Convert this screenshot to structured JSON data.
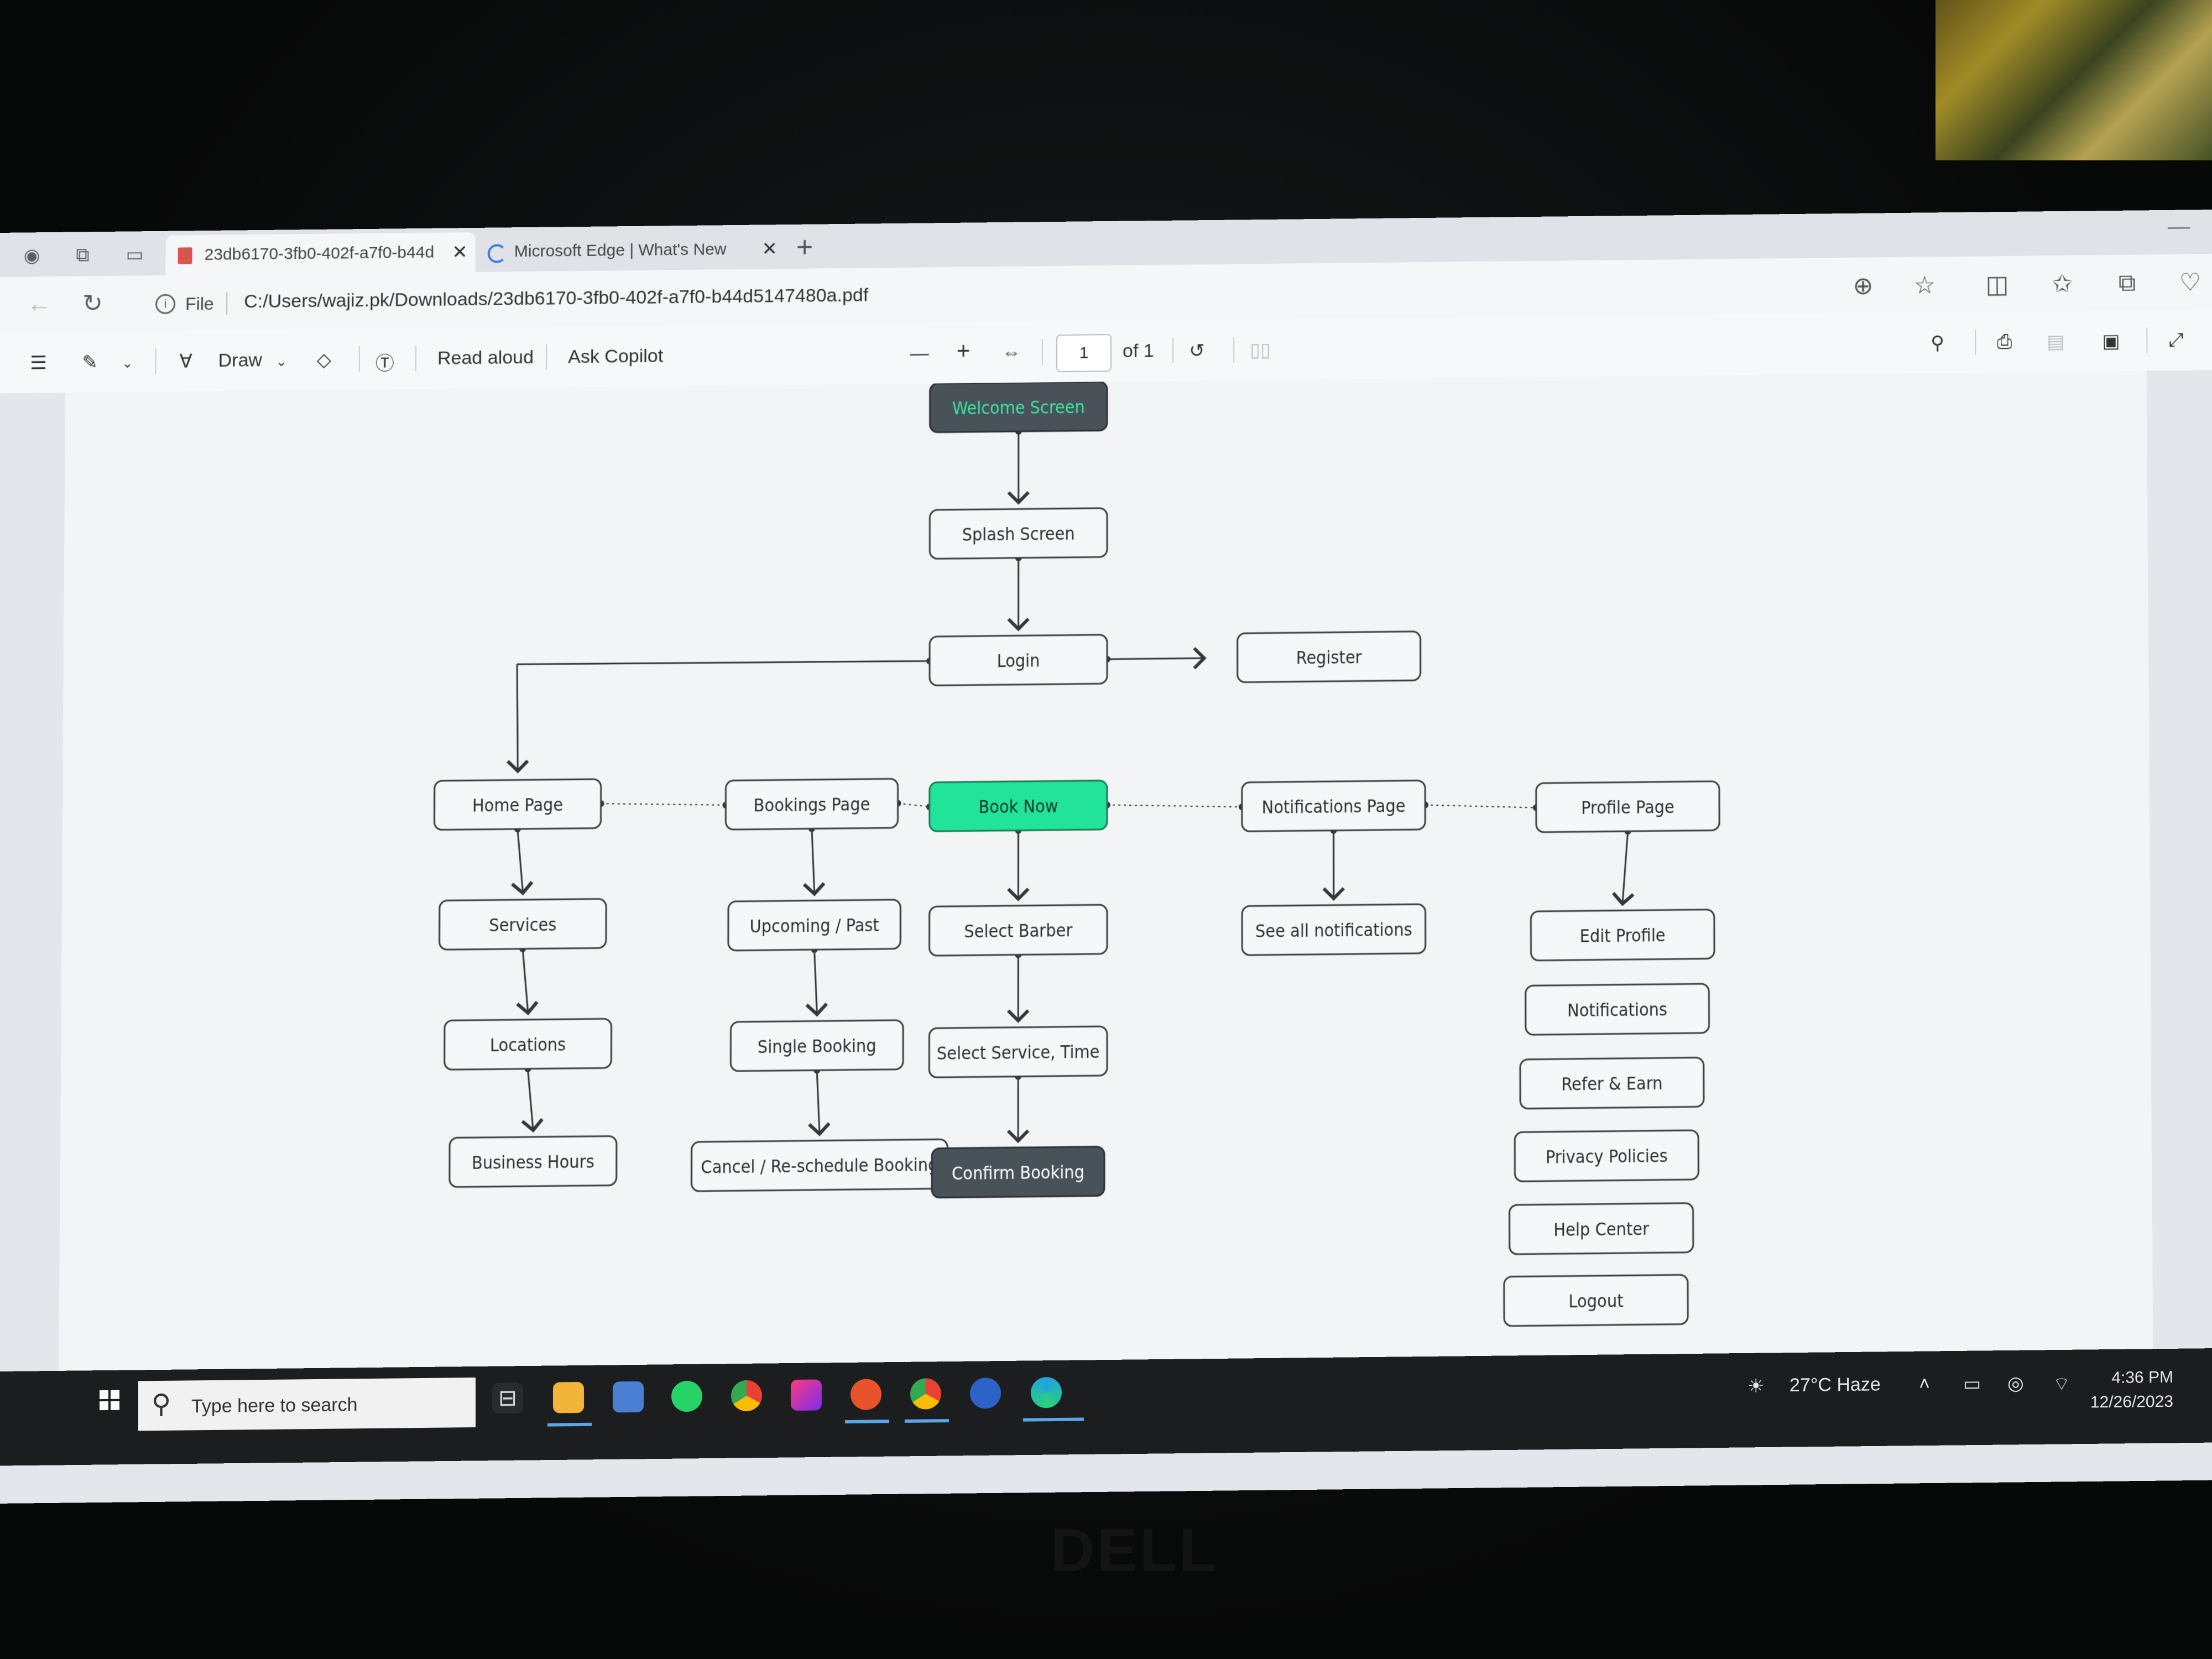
{
  "browser": {
    "tabs": [
      {
        "label": "23db6170-3fb0-402f-a7f0-b44d",
        "close": "✕"
      },
      {
        "label": "Microsoft Edge | What's New",
        "close": "✕"
      }
    ],
    "new_tab": "+",
    "file_label": "File",
    "url": "C:/Users/wajiz.pk/Downloads/23db6170-3fb0-402f-a7f0-b44d5147480a.pdf"
  },
  "pdf_toolbar": {
    "draw": "Draw",
    "read_aloud": "Read aloud",
    "ask_copilot": "Ask Copilot",
    "zoom_out": "—",
    "zoom_in": "+",
    "page_number": "1",
    "page_total": "of 1"
  },
  "diagram": {
    "nodes": {
      "welcome": "Welcome Screen",
      "splash": "Splash Screen",
      "login": "Login",
      "register": "Register",
      "home": "Home Page",
      "bookings": "Bookings Page",
      "book_now": "Book Now",
      "notifications_page": "Notifications Page",
      "profile": "Profile Page",
      "services": "Services",
      "locations": "Locations",
      "business_hours": "Business Hours",
      "upcoming_past": "Upcoming / Past",
      "single_booking": "Single Booking",
      "cancel_reschedule": "Cancel / Re-schedule Booking",
      "select_barber": "Select Barber",
      "select_service_time": "Select Service, Time",
      "confirm_booking": "Confirm Booking",
      "see_all_notifications": "See all notifications",
      "edit_profile": "Edit Profile",
      "notifications": "Notifications",
      "refer_earn": "Refer & Earn",
      "privacy_policies": "Privacy Policies",
      "help_center": "Help Center",
      "logout": "Logout"
    },
    "colors": {
      "dark_node": "#4a5259",
      "dark_node_text_green": "#39e5a0",
      "accent_green": "#22e39a",
      "border": "#3b3f44"
    }
  },
  "taskbar": {
    "search_placeholder": "Type here to search",
    "weather": "27°C  Haze",
    "time": "4:36 PM",
    "date": "12/26/2023"
  }
}
